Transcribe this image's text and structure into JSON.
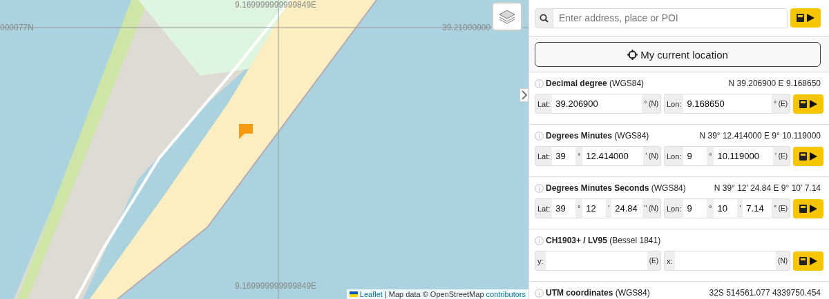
{
  "map": {
    "grid_labels": [
      {
        "kind": "top",
        "text": "9.169999999999849E"
      },
      {
        "kind": "left",
        "text": "000077N"
      },
      {
        "kind": "right",
        "text": "39.21000000"
      },
      {
        "kind": "bottom",
        "text": "9.169999999999849E"
      }
    ],
    "attribution": {
      "leaflet": "Leaflet",
      "rest": "| Map data © OpenStreetMap",
      "contributors": "contributors"
    }
  },
  "search": {
    "placeholder": "Enter address, place or POI"
  },
  "location_button": "My current location",
  "sections": [
    {
      "title": "Decimal degree",
      "datum": "(WGS84)",
      "summary": "N 39.206900 E 9.168650",
      "groups": [
        {
          "label": "Lat:",
          "fields": [
            {
              "value": "39.206900",
              "unit": "° (N)"
            }
          ]
        },
        {
          "label": "Lon:",
          "fields": [
            {
              "value": "9.168650",
              "unit": "° (E)"
            }
          ]
        }
      ]
    },
    {
      "title": "Degrees Minutes",
      "datum": "(WGS84)",
      "summary": "N 39° 12.414000 E 9° 10.119000",
      "groups": [
        {
          "label": "Lat:",
          "fields": [
            {
              "value": "39",
              "unit": "°"
            },
            {
              "value": "12.414000",
              "unit": "' (N)"
            }
          ]
        },
        {
          "label": "Lon:",
          "fields": [
            {
              "value": "9",
              "unit": "°"
            },
            {
              "value": "10.119000",
              "unit": "' (E)"
            }
          ]
        }
      ]
    },
    {
      "title": "Degrees Minutes Seconds",
      "datum": "(WGS84)",
      "summary": "N 39° 12' 24.84 E 9° 10' 7.14",
      "groups": [
        {
          "label": "Lat:",
          "fields": [
            {
              "value": "39",
              "unit": "°"
            },
            {
              "value": "12",
              "unit": "'"
            },
            {
              "value": "24.84",
              "unit": "\" (N)"
            }
          ]
        },
        {
          "label": "Lon:",
          "fields": [
            {
              "value": "9",
              "unit": "°"
            },
            {
              "value": "10",
              "unit": "'"
            },
            {
              "value": "7.14",
              "unit": "\" (E)"
            }
          ]
        }
      ]
    },
    {
      "title": "CH1903+ / LV95",
      "datum": "(Bessel 1841)",
      "groups": [
        {
          "label": "y:",
          "fields": [
            {
              "unit": "(E)"
            }
          ]
        },
        {
          "label": "x:",
          "fields": [
            {
              "unit": "(N)"
            }
          ]
        }
      ]
    },
    {
      "title": "UTM coordinates",
      "datum": "(WGS84)",
      "summary": "32S 514561.077 4339750.454"
    }
  ]
}
